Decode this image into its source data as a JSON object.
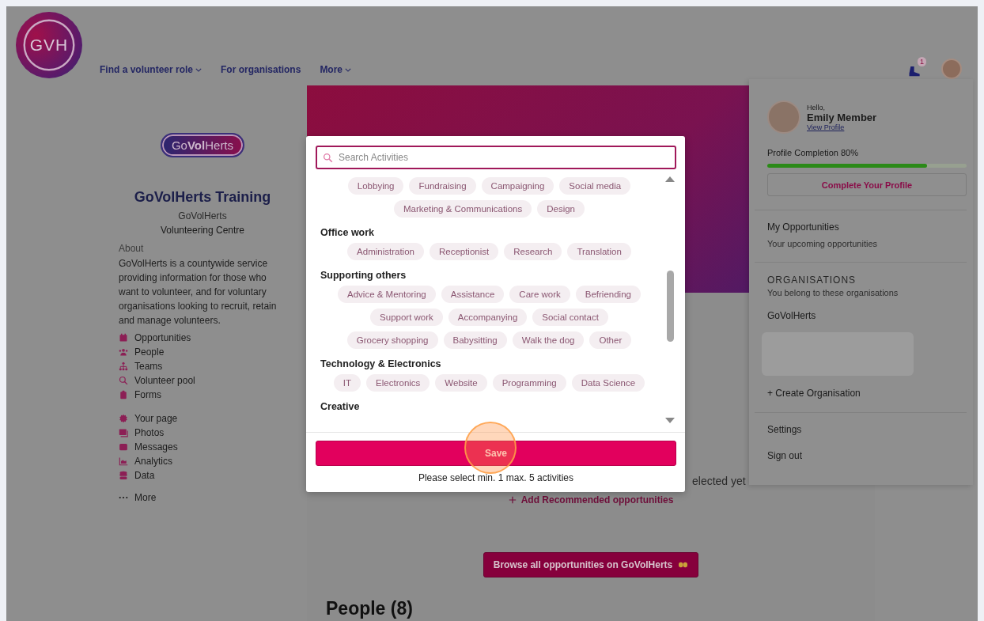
{
  "header": {
    "logo": "GVH",
    "nav": [
      {
        "label": "Find a volunteer role",
        "dropdown": true
      },
      {
        "label": "For organisations",
        "dropdown": false
      },
      {
        "label": "More",
        "dropdown": true
      }
    ],
    "notification_count": "1"
  },
  "sidebar": {
    "badge": "Go**Vol**Herts",
    "title": "GoVolHerts Training",
    "subtitle": "GoVolHerts",
    "type": "Volunteering Centre",
    "about_label": "About",
    "about": "GoVolHerts is a countywide service providing information for those who want to volunteer, and for voluntary organisations looking to recruit, retain and manage volunteers.",
    "menu_groups": [
      [
        "Opportunities",
        "People",
        "Teams",
        "Volunteer pool",
        "Forms"
      ],
      [
        "Your page",
        "Photos",
        "Messages",
        "Analytics",
        "Data"
      ]
    ],
    "more": "More"
  },
  "main": {
    "status_fragment": "elected yet",
    "add_link": "Add Recommended opportunities",
    "browse_button": "Browse all opportunities on GoVolHerts",
    "people_heading": "People (8)"
  },
  "modal": {
    "search": {
      "placeholder": "Search Activities"
    },
    "groups": [
      {
        "activities": [
          {
            "label": "Lobbying",
            "selected": false
          },
          {
            "label": "Fundraising",
            "selected": false
          },
          {
            "label": "Campaigning",
            "selected": false
          },
          {
            "label": "Social media",
            "selected": false
          },
          {
            "label": "Marketing & Communications",
            "selected": false
          },
          {
            "label": "Design",
            "selected": false
          }
        ]
      },
      {
        "heading": "Office work",
        "activities": [
          {
            "label": "Administration",
            "selected": false
          },
          {
            "label": "Receptionist",
            "selected": false
          },
          {
            "label": "Research",
            "selected": false
          },
          {
            "label": "Translation",
            "selected": false
          }
        ]
      },
      {
        "heading": "Supporting others",
        "activities": [
          {
            "label": "Advice & Mentoring",
            "selected": false
          },
          {
            "label": "Assistance",
            "selected": false
          },
          {
            "label": "Care work",
            "selected": false
          },
          {
            "label": "Befriending",
            "selected": false
          },
          {
            "label": "Support work",
            "selected": false
          },
          {
            "label": "Accompanying",
            "selected": false
          },
          {
            "label": "Social contact",
            "selected": false
          },
          {
            "label": "Grocery shopping",
            "selected": false
          },
          {
            "label": "Babysitting",
            "selected": false
          },
          {
            "label": "Walk the dog",
            "selected": false
          },
          {
            "label": "Other",
            "selected": false
          }
        ]
      },
      {
        "heading": "Technology & Electronics",
        "activities": [
          {
            "label": "IT",
            "selected": false
          },
          {
            "label": "Electronics",
            "selected": false
          },
          {
            "label": "Website",
            "selected": false
          },
          {
            "label": "Programming",
            "selected": false
          },
          {
            "label": "Data Science",
            "selected": false
          }
        ]
      },
      {
        "heading": "Creative"
      }
    ],
    "save_button": "Save",
    "note": "Please select min. 1 max. 5 activities"
  },
  "user_menu": {
    "greeting": "Hello,",
    "name": "Emily Member",
    "view_profile": "View Profile",
    "progress": {
      "label": "Profile Completion 80%",
      "level": 0.8
    },
    "complete_button": "Complete Your Profile",
    "my_opportunities": "My Opportunities",
    "my_opportunities_hint": "Your upcoming opportunities",
    "organisations_heading": "ORGANISATIONS",
    "organisations_hint": "You belong to these organisations",
    "organisations": [
      "GoVolHerts"
    ],
    "create_org": "+ Create Organisation",
    "settings": "Settings",
    "sign_out": "Sign out"
  }
}
